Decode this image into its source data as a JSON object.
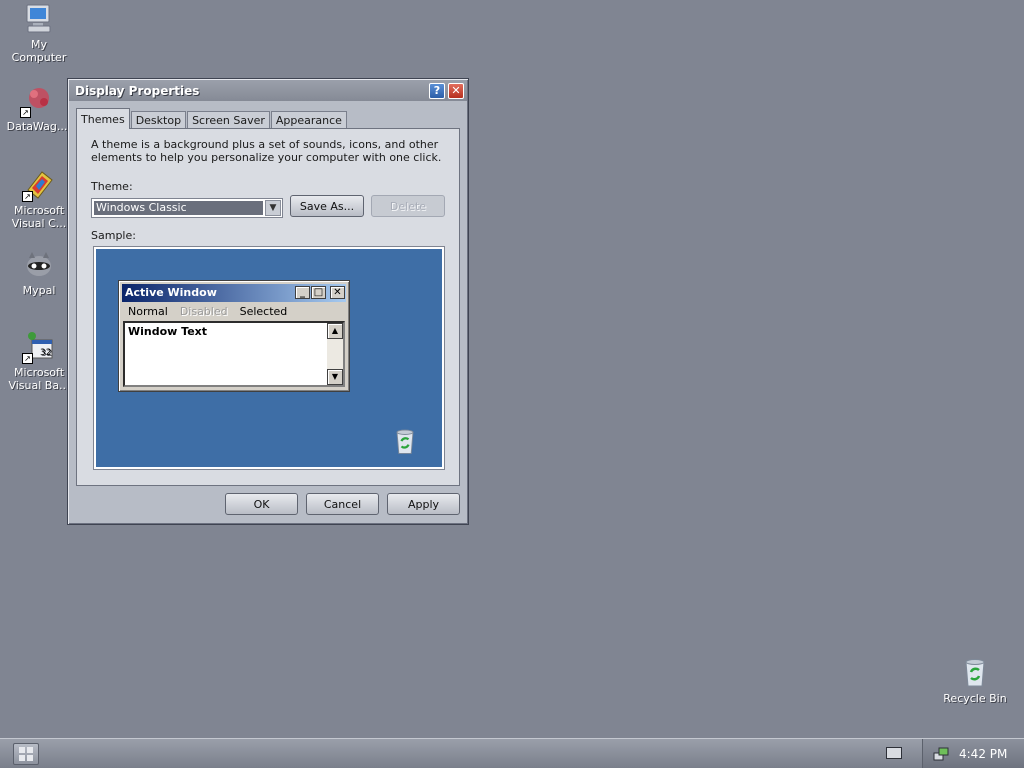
{
  "desktop": {
    "icons": [
      {
        "label": "My\nComputer",
        "icon": "my-computer-icon"
      },
      {
        "label": "DataWag...",
        "icon": "datawag-icon"
      },
      {
        "label": "Microsoft\nVisual C...",
        "icon": "visual-c-icon"
      },
      {
        "label": "Mypal",
        "icon": "mypal-icon"
      },
      {
        "label": "Microsoft\nVisual Ba...",
        "icon": "visual-basic-icon"
      },
      {
        "label": "Recycle Bin",
        "icon": "recycle-bin-icon"
      }
    ]
  },
  "dialog": {
    "title": "Display Properties",
    "tabs": [
      "Themes",
      "Desktop",
      "Screen Saver",
      "Appearance"
    ],
    "active_tab": "Themes",
    "description": "A theme is a background plus a set of sounds, icons, and other elements to help you personalize your computer with one click.",
    "theme_label": "Theme:",
    "theme_value": "Windows Classic",
    "save_as_label": "Save As...",
    "delete_label": "Delete",
    "sample_label": "Sample:",
    "sample": {
      "window_title": "Active Window",
      "menu": {
        "normal": "Normal",
        "disabled": "Disabled",
        "selected": "Selected"
      },
      "window_text": "Window Text"
    },
    "ok_label": "OK",
    "cancel_label": "Cancel",
    "apply_label": "Apply"
  },
  "taskbar": {
    "clock": "4:42 PM"
  },
  "colors": {
    "desktop_bg": "#808592",
    "sample_bg": "#3e6ea6",
    "active_title_start": "#0a246a",
    "active_title_end": "#a6caf0",
    "close_button": "#c23a28"
  }
}
